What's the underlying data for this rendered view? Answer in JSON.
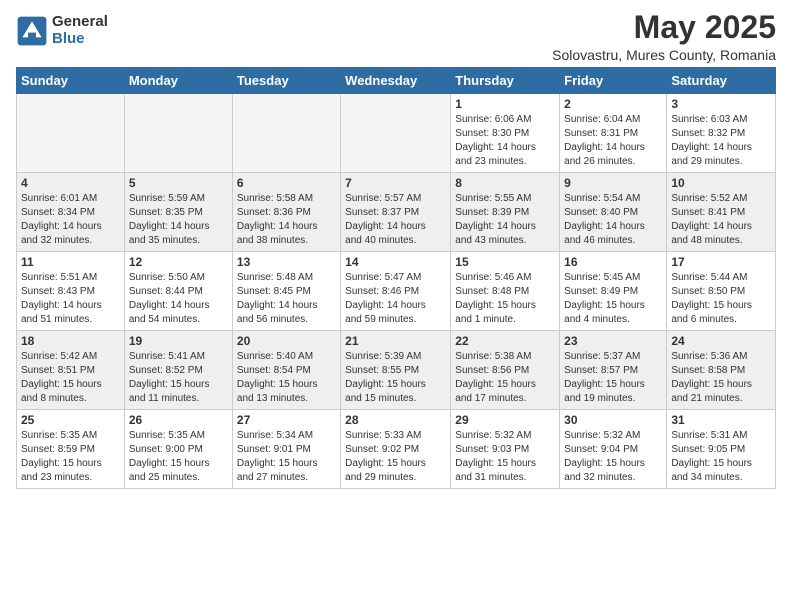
{
  "logo": {
    "general": "General",
    "blue": "Blue"
  },
  "header": {
    "month": "May 2025",
    "location": "Solovastru, Mures County, Romania"
  },
  "days_of_week": [
    "Sunday",
    "Monday",
    "Tuesday",
    "Wednesday",
    "Thursday",
    "Friday",
    "Saturday"
  ],
  "weeks": [
    [
      {
        "day": "",
        "info": ""
      },
      {
        "day": "",
        "info": ""
      },
      {
        "day": "",
        "info": ""
      },
      {
        "day": "",
        "info": ""
      },
      {
        "day": "1",
        "info": "Sunrise: 6:06 AM\nSunset: 8:30 PM\nDaylight: 14 hours\nand 23 minutes."
      },
      {
        "day": "2",
        "info": "Sunrise: 6:04 AM\nSunset: 8:31 PM\nDaylight: 14 hours\nand 26 minutes."
      },
      {
        "day": "3",
        "info": "Sunrise: 6:03 AM\nSunset: 8:32 PM\nDaylight: 14 hours\nand 29 minutes."
      }
    ],
    [
      {
        "day": "4",
        "info": "Sunrise: 6:01 AM\nSunset: 8:34 PM\nDaylight: 14 hours\nand 32 minutes."
      },
      {
        "day": "5",
        "info": "Sunrise: 5:59 AM\nSunset: 8:35 PM\nDaylight: 14 hours\nand 35 minutes."
      },
      {
        "day": "6",
        "info": "Sunrise: 5:58 AM\nSunset: 8:36 PM\nDaylight: 14 hours\nand 38 minutes."
      },
      {
        "day": "7",
        "info": "Sunrise: 5:57 AM\nSunset: 8:37 PM\nDaylight: 14 hours\nand 40 minutes."
      },
      {
        "day": "8",
        "info": "Sunrise: 5:55 AM\nSunset: 8:39 PM\nDaylight: 14 hours\nand 43 minutes."
      },
      {
        "day": "9",
        "info": "Sunrise: 5:54 AM\nSunset: 8:40 PM\nDaylight: 14 hours\nand 46 minutes."
      },
      {
        "day": "10",
        "info": "Sunrise: 5:52 AM\nSunset: 8:41 PM\nDaylight: 14 hours\nand 48 minutes."
      }
    ],
    [
      {
        "day": "11",
        "info": "Sunrise: 5:51 AM\nSunset: 8:43 PM\nDaylight: 14 hours\nand 51 minutes."
      },
      {
        "day": "12",
        "info": "Sunrise: 5:50 AM\nSunset: 8:44 PM\nDaylight: 14 hours\nand 54 minutes."
      },
      {
        "day": "13",
        "info": "Sunrise: 5:48 AM\nSunset: 8:45 PM\nDaylight: 14 hours\nand 56 minutes."
      },
      {
        "day": "14",
        "info": "Sunrise: 5:47 AM\nSunset: 8:46 PM\nDaylight: 14 hours\nand 59 minutes."
      },
      {
        "day": "15",
        "info": "Sunrise: 5:46 AM\nSunset: 8:48 PM\nDaylight: 15 hours\nand 1 minute."
      },
      {
        "day": "16",
        "info": "Sunrise: 5:45 AM\nSunset: 8:49 PM\nDaylight: 15 hours\nand 4 minutes."
      },
      {
        "day": "17",
        "info": "Sunrise: 5:44 AM\nSunset: 8:50 PM\nDaylight: 15 hours\nand 6 minutes."
      }
    ],
    [
      {
        "day": "18",
        "info": "Sunrise: 5:42 AM\nSunset: 8:51 PM\nDaylight: 15 hours\nand 8 minutes."
      },
      {
        "day": "19",
        "info": "Sunrise: 5:41 AM\nSunset: 8:52 PM\nDaylight: 15 hours\nand 11 minutes."
      },
      {
        "day": "20",
        "info": "Sunrise: 5:40 AM\nSunset: 8:54 PM\nDaylight: 15 hours\nand 13 minutes."
      },
      {
        "day": "21",
        "info": "Sunrise: 5:39 AM\nSunset: 8:55 PM\nDaylight: 15 hours\nand 15 minutes."
      },
      {
        "day": "22",
        "info": "Sunrise: 5:38 AM\nSunset: 8:56 PM\nDaylight: 15 hours\nand 17 minutes."
      },
      {
        "day": "23",
        "info": "Sunrise: 5:37 AM\nSunset: 8:57 PM\nDaylight: 15 hours\nand 19 minutes."
      },
      {
        "day": "24",
        "info": "Sunrise: 5:36 AM\nSunset: 8:58 PM\nDaylight: 15 hours\nand 21 minutes."
      }
    ],
    [
      {
        "day": "25",
        "info": "Sunrise: 5:35 AM\nSunset: 8:59 PM\nDaylight: 15 hours\nand 23 minutes."
      },
      {
        "day": "26",
        "info": "Sunrise: 5:35 AM\nSunset: 9:00 PM\nDaylight: 15 hours\nand 25 minutes."
      },
      {
        "day": "27",
        "info": "Sunrise: 5:34 AM\nSunset: 9:01 PM\nDaylight: 15 hours\nand 27 minutes."
      },
      {
        "day": "28",
        "info": "Sunrise: 5:33 AM\nSunset: 9:02 PM\nDaylight: 15 hours\nand 29 minutes."
      },
      {
        "day": "29",
        "info": "Sunrise: 5:32 AM\nSunset: 9:03 PM\nDaylight: 15 hours\nand 31 minutes."
      },
      {
        "day": "30",
        "info": "Sunrise: 5:32 AM\nSunset: 9:04 PM\nDaylight: 15 hours\nand 32 minutes."
      },
      {
        "day": "31",
        "info": "Sunrise: 5:31 AM\nSunset: 9:05 PM\nDaylight: 15 hours\nand 34 minutes."
      }
    ]
  ]
}
